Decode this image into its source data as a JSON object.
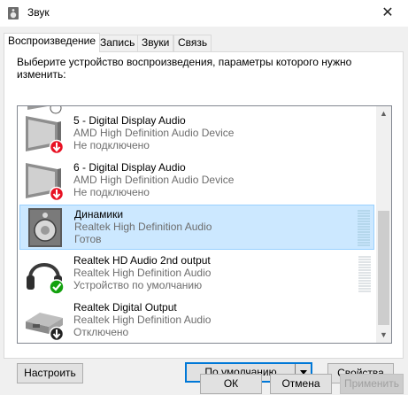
{
  "window": {
    "title": "Звук",
    "close_glyph": "✕"
  },
  "tabs": [
    {
      "label": "Воспроизведение",
      "active": true
    },
    {
      "label": "Запись",
      "active": false
    },
    {
      "label": "Звуки",
      "active": false
    },
    {
      "label": "Связь",
      "active": false
    }
  ],
  "instructions": "Выберите устройство воспроизведения, параметры которого нужно изменить:",
  "devices": [
    {
      "name": "5 - Digital Display Audio",
      "device": "AMD High Definition Audio Device",
      "status": "Не подключено",
      "icon": "monitor-icon",
      "badge": "red-down-arrow",
      "selected": false
    },
    {
      "name": "6 - Digital Display Audio",
      "device": "AMD High Definition Audio Device",
      "status": "Не подключено",
      "icon": "monitor-icon",
      "badge": "red-down-arrow",
      "selected": false
    },
    {
      "name": "Динамики",
      "device": "Realtek High Definition Audio",
      "status": "Готов",
      "icon": "speaker-icon",
      "badge": "",
      "selected": true
    },
    {
      "name": "Realtek HD Audio 2nd output",
      "device": "Realtek High Definition Audio",
      "status": "Устройство по умолчанию",
      "icon": "headphones-icon",
      "badge": "green-check",
      "selected": false
    },
    {
      "name": "Realtek Digital Output",
      "device": "Realtek High Definition Audio",
      "status": "Отключено",
      "icon": "digital-output-icon",
      "badge": "black-down-arrow",
      "selected": false
    }
  ],
  "buttons": {
    "configure": "Настроить",
    "set_default": "По умолчанию",
    "properties": "Свойства",
    "ok": "ОК",
    "cancel": "Отмена",
    "apply": "Применить"
  },
  "colors": {
    "selection": "#cce8ff",
    "focus": "#0078d7",
    "error": "#e81123",
    "ok": "#13a10e"
  }
}
